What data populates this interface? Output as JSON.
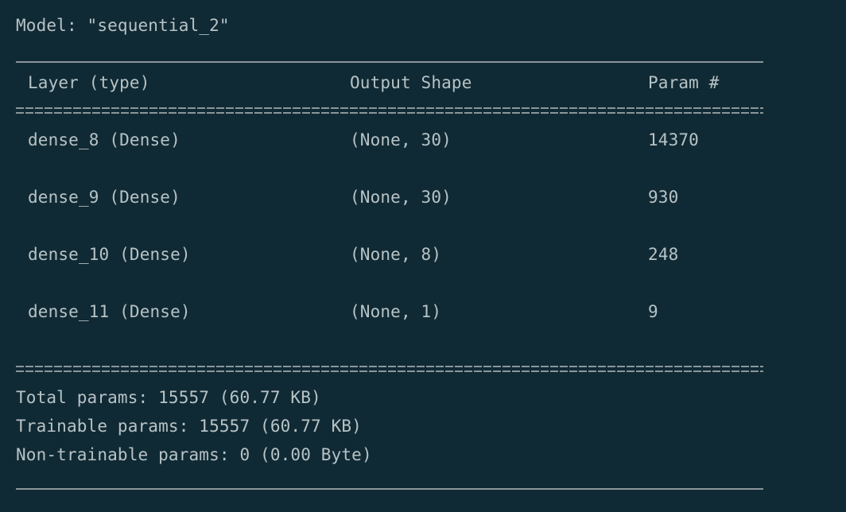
{
  "model": {
    "title": "Model: \"sequential_2\""
  },
  "table": {
    "headers": {
      "layer": "Layer (type)",
      "shape": "Output Shape",
      "param": "Param #"
    },
    "rows": [
      {
        "layer": "dense_8 (Dense)",
        "shape": "(None, 30)",
        "param": "14370"
      },
      {
        "layer": "dense_9 (Dense)",
        "shape": "(None, 30)",
        "param": "930"
      },
      {
        "layer": "dense_10 (Dense)",
        "shape": "(None, 8)",
        "param": "248"
      },
      {
        "layer": "dense_11 (Dense)",
        "shape": "(None, 1)",
        "param": "9"
      }
    ]
  },
  "summary": {
    "total": "Total params: 15557 (60.77 KB)",
    "trainable": "Trainable params: 15557 (60.77 KB)",
    "non_trainable": "Non-trainable params: 0 (0.00 Byte)"
  },
  "colors": {
    "background": "#102a35",
    "text": "#b7c3c5",
    "rule": "#8a9699"
  }
}
